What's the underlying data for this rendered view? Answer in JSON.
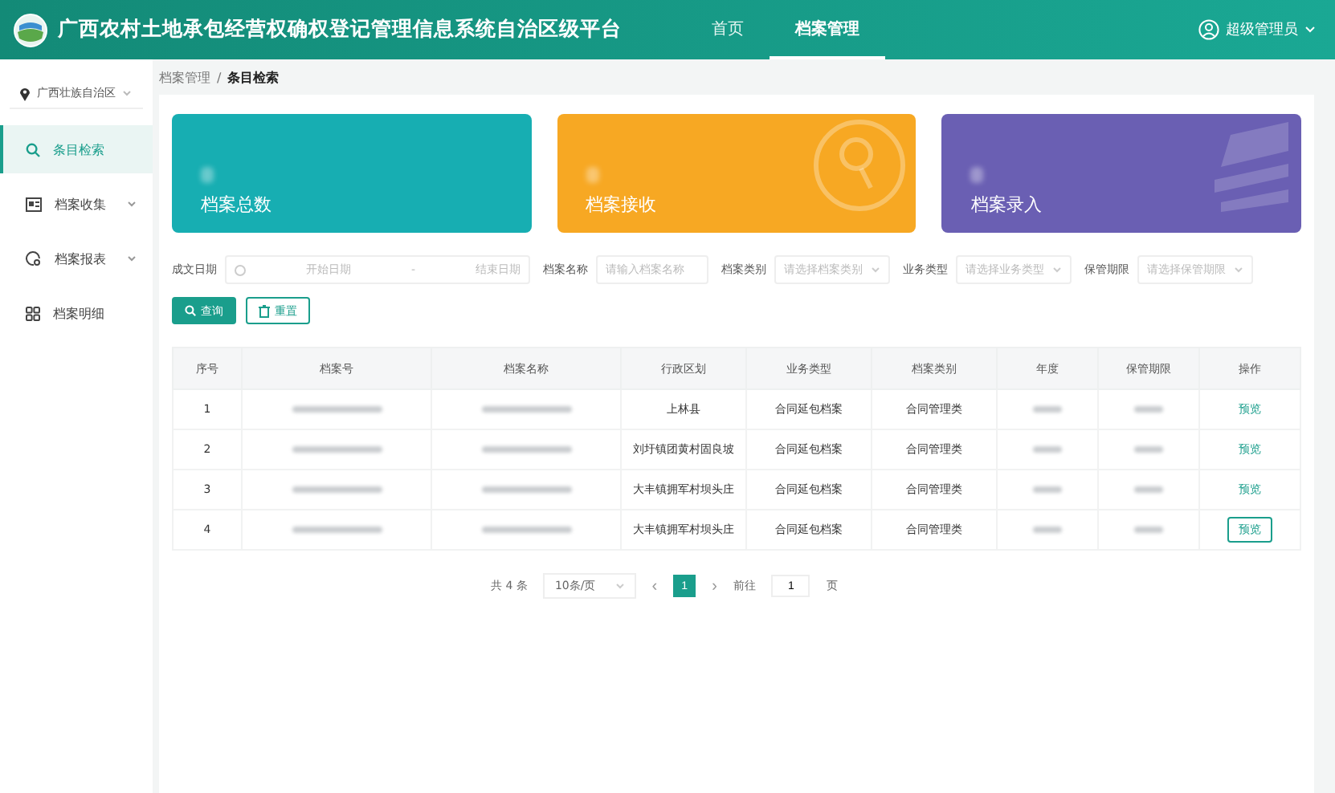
{
  "header": {
    "title": "广西农村土地承包经营权确权登记管理信息系统自治区级平台",
    "nav": [
      {
        "label": "首页",
        "selected": false
      },
      {
        "label": "档案管理",
        "selected": true
      }
    ],
    "user": "超级管理员"
  },
  "sidebar": {
    "region": "广西壮族自治区",
    "items": [
      {
        "label": "条目检索",
        "kind": "search",
        "selected": true,
        "expandable": false
      },
      {
        "label": "档案收集",
        "kind": "collect",
        "selected": false,
        "expandable": true
      },
      {
        "label": "档案报表",
        "kind": "report",
        "selected": false,
        "expandable": true
      },
      {
        "label": "档案明细",
        "kind": "grid",
        "selected": false,
        "expandable": false
      }
    ]
  },
  "breadcrumb": {
    "separator": "/",
    "items": [
      {
        "label": "档案管理",
        "current": false
      },
      {
        "label": "条目检索",
        "current": true
      }
    ]
  },
  "cards": [
    {
      "label": "档案总数",
      "kind": "teal"
    },
    {
      "label": "档案接收",
      "kind": "orange"
    },
    {
      "label": "档案录入",
      "kind": "purple"
    }
  ],
  "filters": [
    {
      "label": "成文日期",
      "kind": "daterange",
      "start": "开始日期",
      "separator": "-",
      "end": "结束日期"
    },
    {
      "label": "档案名称",
      "kind": "input",
      "placeholder": "请输入档案名称"
    },
    {
      "label": "档案类别",
      "kind": "select",
      "placeholder": "请选择档案类别"
    },
    {
      "label": "业务类型",
      "kind": "select",
      "placeholder": "请选择业务类型"
    },
    {
      "label": "保管期限",
      "kind": "select",
      "placeholder": "请选择保管期限"
    }
  ],
  "buttons": [
    {
      "label": "查询",
      "kind": "primary"
    },
    {
      "label": "重置",
      "kind": "plain"
    }
  ],
  "table": {
    "columns": [
      "序号",
      "档案号",
      "档案名称",
      "行政区划",
      "业务类型",
      "档案类别",
      "年度",
      "保管期限",
      "操作"
    ],
    "rows": [
      {
        "cells": [
          {
            "kind": "text",
            "text": "1"
          },
          {
            "kind": "blurred"
          },
          {
            "kind": "blurred"
          },
          {
            "kind": "text",
            "text": "上林县"
          },
          {
            "kind": "text",
            "text": "合同延包档案"
          },
          {
            "kind": "text",
            "text": "合同管理类"
          },
          {
            "kind": "blurred"
          },
          {
            "kind": "blurred"
          },
          {
            "kind": "action",
            "text": "预览",
            "focused": false
          }
        ]
      },
      {
        "cells": [
          {
            "kind": "text",
            "text": "2"
          },
          {
            "kind": "blurred"
          },
          {
            "kind": "blurred"
          },
          {
            "kind": "text",
            "text": "刘圩镇团黄村固良坡"
          },
          {
            "kind": "text",
            "text": "合同延包档案"
          },
          {
            "kind": "text",
            "text": "合同管理类"
          },
          {
            "kind": "blurred"
          },
          {
            "kind": "blurred"
          },
          {
            "kind": "action",
            "text": "预览",
            "focused": false
          }
        ]
      },
      {
        "cells": [
          {
            "kind": "text",
            "text": "3"
          },
          {
            "kind": "blurred"
          },
          {
            "kind": "blurred"
          },
          {
            "kind": "text",
            "text": "大丰镇拥军村坝头庄"
          },
          {
            "kind": "text",
            "text": "合同延包档案"
          },
          {
            "kind": "text",
            "text": "合同管理类"
          },
          {
            "kind": "blurred"
          },
          {
            "kind": "blurred"
          },
          {
            "kind": "action",
            "text": "预览",
            "focused": false
          }
        ]
      },
      {
        "cells": [
          {
            "kind": "text",
            "text": "4"
          },
          {
            "kind": "blurred"
          },
          {
            "kind": "blurred"
          },
          {
            "kind": "text",
            "text": "大丰镇拥军村坝头庄"
          },
          {
            "kind": "text",
            "text": "合同延包档案"
          },
          {
            "kind": "text",
            "text": "合同管理类"
          },
          {
            "kind": "blurred"
          },
          {
            "kind": "blurred"
          },
          {
            "kind": "action",
            "text": "预览",
            "focused": true
          }
        ]
      }
    ]
  },
  "pagination": {
    "total": "共 4 条",
    "page_size": "10条/页",
    "prev": "‹",
    "pages": [
      {
        "label": "1",
        "selected": true
      }
    ],
    "next": "›",
    "goto": "前往",
    "goto_value": "1",
    "page_unit": "页"
  }
}
